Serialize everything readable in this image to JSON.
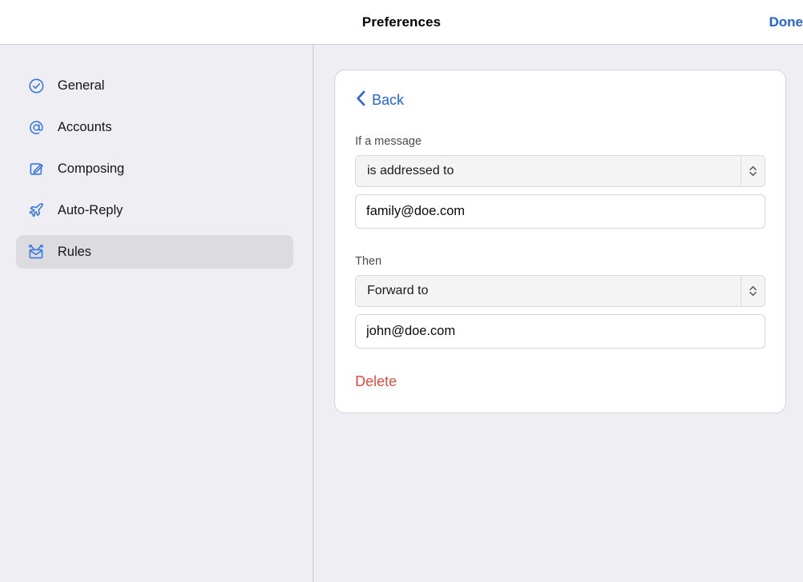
{
  "titlebar": {
    "title": "Preferences",
    "done_label": "Done"
  },
  "sidebar": {
    "items": [
      {
        "label": "General",
        "icon": "check-circle-icon",
        "selected": false
      },
      {
        "label": "Accounts",
        "icon": "at-sign-icon",
        "selected": false
      },
      {
        "label": "Composing",
        "icon": "compose-square-pencil-icon",
        "selected": false
      },
      {
        "label": "Auto-Reply",
        "icon": "paper-plane-icon",
        "selected": false
      },
      {
        "label": "Rules",
        "icon": "envelope-rules-icon",
        "selected": true
      }
    ]
  },
  "rule_editor": {
    "back_label": "Back",
    "back_icon": "chevron-left-icon",
    "condition": {
      "label": "If a message",
      "select_value": "is addressed to",
      "select_icon": "updown-chevrons-icon",
      "input_value": "family@doe.com",
      "input_placeholder": ""
    },
    "action": {
      "label": "Then",
      "select_value": "Forward to",
      "select_icon": "updown-chevrons-icon",
      "input_value": "john@doe.com",
      "input_placeholder": ""
    },
    "delete_label": "Delete"
  },
  "colors": {
    "accent_blue": "#2563d6",
    "icon_blue": "#3578e5",
    "destructive_red": "#e14c3c",
    "page_background": "#eeeef3",
    "card_background": "#ffffff",
    "selected_row": "#dcdcdf"
  }
}
